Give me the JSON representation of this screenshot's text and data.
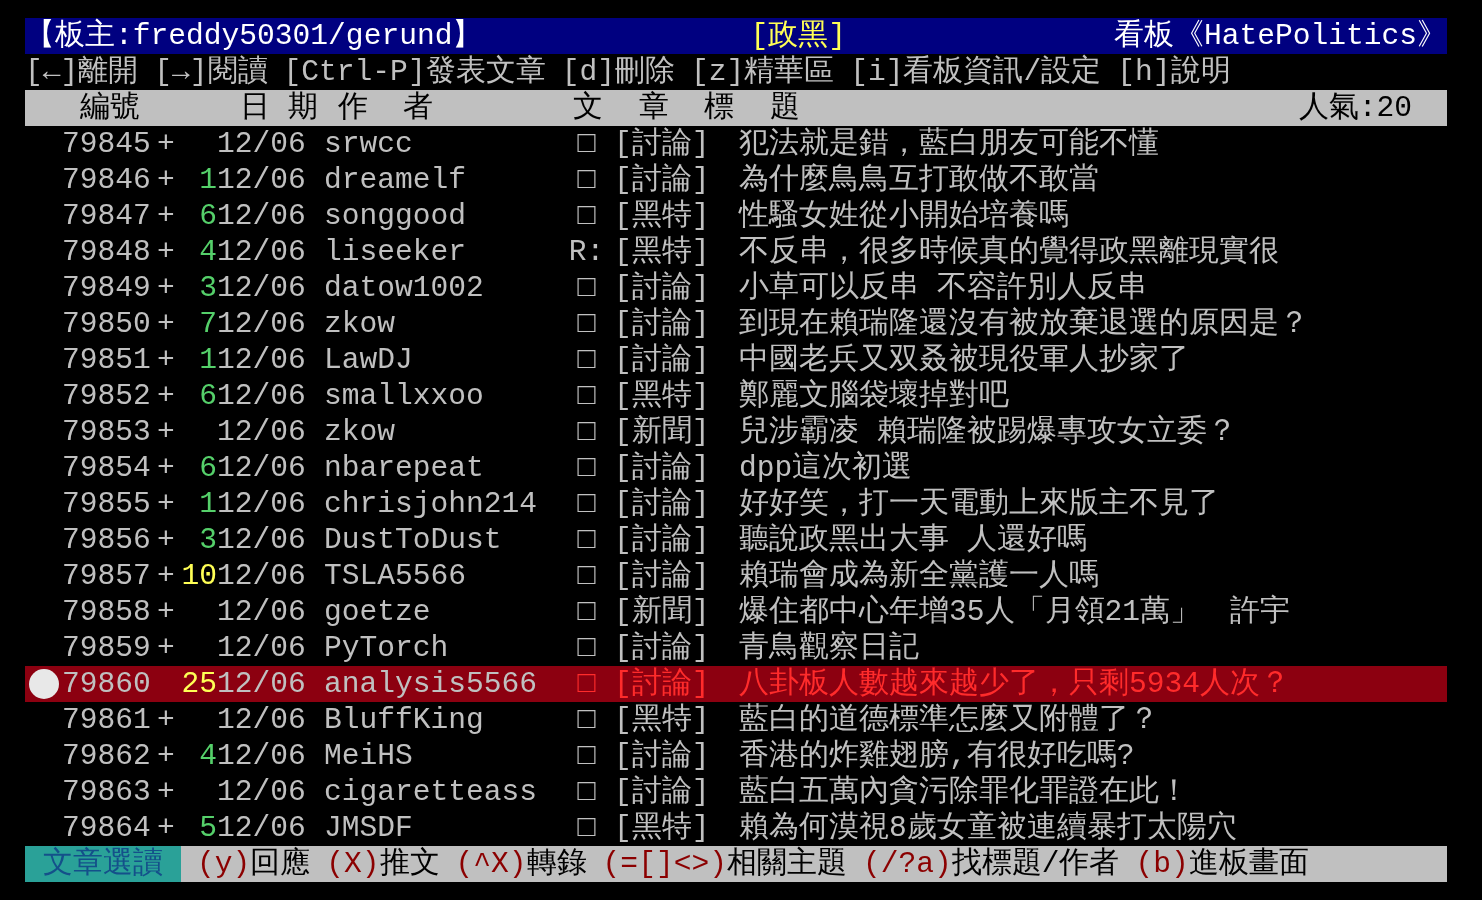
{
  "header": {
    "moderator": "【板主:freddy50301/gerund】",
    "category": "[政黑]",
    "board": "看板《HatePolitics》"
  },
  "menu": [
    "[←]離開",
    "[→]閱讀",
    "[Ctrl-P]發表文章",
    "[d]刪除",
    "[z]精華區",
    "[i]看板資訊/設定",
    "[h]說明"
  ],
  "columns": {
    "number": "編號",
    "date": "日 期",
    "author": "作  者",
    "title": "文  章  標  題",
    "popularity": "人氣:20"
  },
  "rows": [
    {
      "number": "79845",
      "flag": "+",
      "date": "12/06",
      "author": "srwcc",
      "mark": "□",
      "category": "[討論]",
      "title": "犯法就是錯，藍白朋友可能不懂",
      "selected": false
    },
    {
      "number": "79846",
      "flag": "+",
      "count": "1",
      "date": "12/06",
      "author": "dreamelf",
      "mark": "□",
      "category": "[討論]",
      "title": "為什麼鳥鳥互打敢做不敢當",
      "selected": false
    },
    {
      "number": "79847",
      "flag": "+",
      "count": "6",
      "date": "12/06",
      "author": "songgood",
      "mark": "□",
      "category": "[黑特]",
      "title": "性騷女姓從小開始培養嗎",
      "selected": false
    },
    {
      "number": "79848",
      "flag": "+",
      "count": "4",
      "date": "12/06",
      "author": "liseeker",
      "mark": "R:",
      "category": "[黑特]",
      "title": "不反串，很多時候真的覺得政黑離現實很",
      "selected": false
    },
    {
      "number": "79849",
      "flag": "+",
      "count": "3",
      "date": "12/06",
      "author": "datow1002",
      "mark": "□",
      "category": "[討論]",
      "title": "小草可以反串 不容許別人反串",
      "selected": false
    },
    {
      "number": "79850",
      "flag": "+",
      "count": "7",
      "date": "12/06",
      "author": "zkow",
      "mark": "□",
      "category": "[討論]",
      "title": "到現在賴瑞隆還沒有被放棄退選的原因是？",
      "selected": false
    },
    {
      "number": "79851",
      "flag": "+",
      "count": "1",
      "date": "12/06",
      "author": "LawDJ",
      "mark": "□",
      "category": "[討論]",
      "title": "中國老兵又双叒被現役軍人抄家了",
      "selected": false
    },
    {
      "number": "79852",
      "flag": "+",
      "count": "6",
      "date": "12/06",
      "author": "smallxxoo",
      "mark": "□",
      "category": "[黑特]",
      "title": "鄭麗文腦袋壞掉對吧",
      "selected": false
    },
    {
      "number": "79853",
      "flag": "+",
      "date": "12/06",
      "author": "zkow",
      "mark": "□",
      "category": "[新聞]",
      "title": "兒涉霸凌 賴瑞隆被踢爆專攻女立委？",
      "selected": false
    },
    {
      "number": "79854",
      "flag": "+",
      "count": "6",
      "date": "12/06",
      "author": "nbarepeat",
      "mark": "□",
      "category": "[討論]",
      "title": "dpp這次初選",
      "selected": false
    },
    {
      "number": "79855",
      "flag": "+",
      "count": "1",
      "date": "12/06",
      "author": "chrisjohn214",
      "mark": "□",
      "category": "[討論]",
      "title": "好好笑，打一天電動上來版主不見了",
      "selected": false
    },
    {
      "number": "79856",
      "flag": "+",
      "count": "3",
      "date": "12/06",
      "author": "DustToDust",
      "mark": "□",
      "category": "[討論]",
      "title": "聽說政黑出大事 人還好嗎",
      "selected": false
    },
    {
      "number": "79857",
      "flag": "+",
      "count": "10",
      "date": "12/06",
      "author": "TSLA5566",
      "mark": "□",
      "category": "[討論]",
      "title": "賴瑞會成為新全黨護一人嗎",
      "selected": false
    },
    {
      "number": "79858",
      "flag": "+",
      "date": "12/06",
      "author": "goetze",
      "mark": "□",
      "category": "[新聞]",
      "title": "爆住都中心年增35人「月領21萬」　許宇",
      "selected": false
    },
    {
      "number": "79859",
      "flag": "+",
      "date": "12/06",
      "author": "PyTorch",
      "mark": "□",
      "category": "[討論]",
      "title": "青鳥觀察日記",
      "selected": false
    },
    {
      "number": "79860",
      "count": "25",
      "date": "12/06",
      "author": "analysis5566",
      "mark": "□",
      "category": "[討論]",
      "title": "八卦板人數越來越少了，只剩5934人次？",
      "selected": true
    },
    {
      "number": "79861",
      "flag": "+",
      "date": "12/06",
      "author": "BluffKing",
      "mark": "□",
      "category": "[黑特]",
      "title": "藍白的道德標準怎麼又附體了？",
      "selected": false
    },
    {
      "number": "79862",
      "flag": "+",
      "count": "4",
      "date": "12/06",
      "author": "MeiHS",
      "mark": "□",
      "category": "[討論]",
      "title": "香港的炸雞翅膀,有很好吃嗎?",
      "selected": false
    },
    {
      "number": "79863",
      "flag": "+",
      "date": "12/06",
      "author": "cigaretteass",
      "mark": "□",
      "category": "[討論]",
      "title": "藍白五萬內貪污除罪化罪證在此！",
      "selected": false
    },
    {
      "number": "79864",
      "flag": "+",
      "count": "5",
      "date": "12/06",
      "author": "JMSDF",
      "mark": "□",
      "category": "[黑特]",
      "title": "賴為何漠視8歲女童被連續暴打太陽穴",
      "selected": false
    }
  ],
  "footer": {
    "mode": "文章選讀",
    "keys": [
      {
        "key": "(y)",
        "label": "回應"
      },
      {
        "key": "(X)",
        "label": "推文"
      },
      {
        "key": "(^X)",
        "label": "轉錄"
      },
      {
        "key": "(=[]<>)",
        "label": "相關主題"
      },
      {
        "key": "(/?a)",
        "label": "找標題/作者"
      },
      {
        "key": "(b)",
        "label": "進板畫面"
      }
    ]
  }
}
